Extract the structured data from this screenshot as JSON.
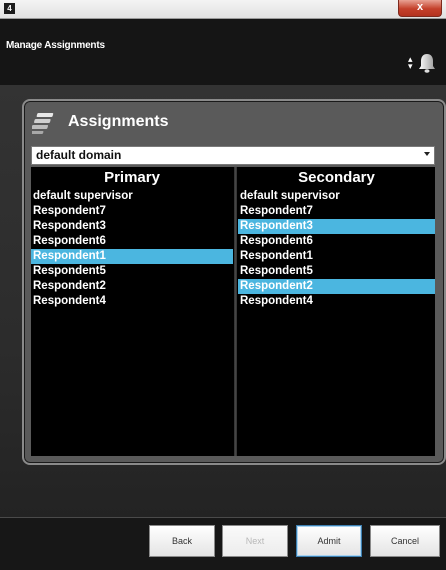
{
  "window": {
    "icon_text": "4",
    "close_label": "x"
  },
  "header": {
    "title": "Manage Assignments",
    "notification_icon": "bell-icon",
    "sort_icon": "updown-arrows-icon"
  },
  "panel": {
    "icon": "stack-icon",
    "title": "Assignments",
    "domain_select": {
      "value": "default domain"
    },
    "primary": {
      "heading": "Primary",
      "items": [
        {
          "label": "default supervisor",
          "selected": false
        },
        {
          "label": "Respondent7",
          "selected": false
        },
        {
          "label": "Respondent3",
          "selected": false
        },
        {
          "label": "Respondent6",
          "selected": false
        },
        {
          "label": "Respondent1",
          "selected": true
        },
        {
          "label": "Respondent5",
          "selected": false
        },
        {
          "label": "Respondent2",
          "selected": false
        },
        {
          "label": "Respondent4",
          "selected": false
        }
      ]
    },
    "secondary": {
      "heading": "Secondary",
      "items": [
        {
          "label": "default supervisor",
          "selected": false
        },
        {
          "label": "Respondent7",
          "selected": false
        },
        {
          "label": "Respondent3",
          "selected": true
        },
        {
          "label": "Respondent6",
          "selected": false
        },
        {
          "label": "Respondent1",
          "selected": false
        },
        {
          "label": "Respondent5",
          "selected": false
        },
        {
          "label": "Respondent2",
          "selected": true
        },
        {
          "label": "Respondent4",
          "selected": false
        }
      ]
    },
    "selection_color": "#4bb6e0"
  },
  "footer": {
    "back_label": "Back",
    "next_label": "Next",
    "admit_label": "Admit",
    "cancel_label": "Cancel"
  }
}
